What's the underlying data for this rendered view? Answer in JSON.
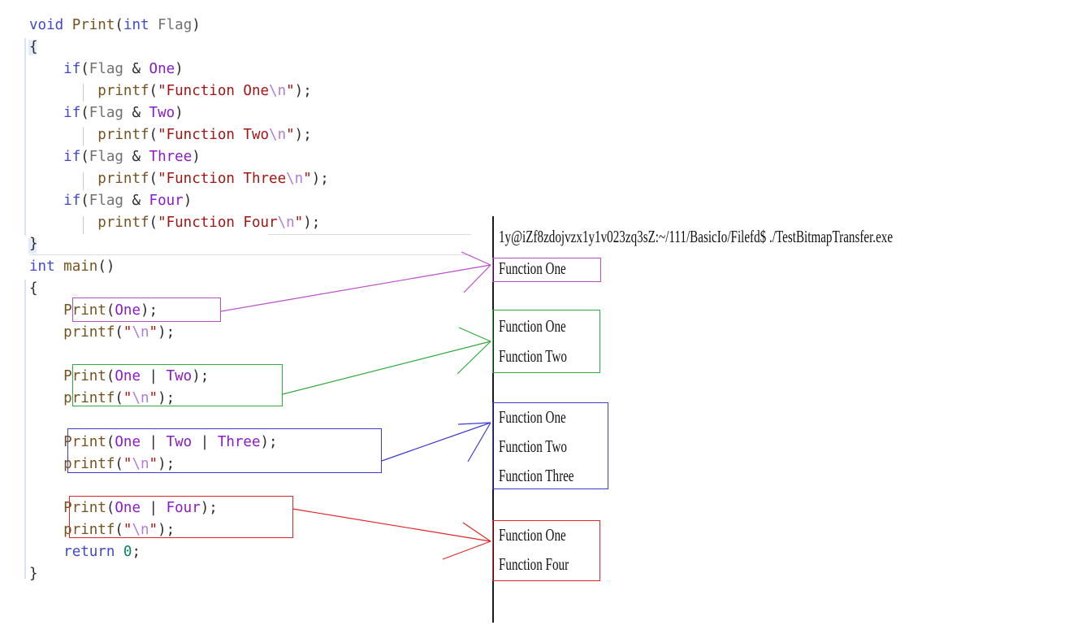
{
  "code": {
    "lines": [
      {
        "tokens": [
          {
            "t": "void",
            "c": "kw"
          },
          {
            "t": " ",
            "c": "punc"
          },
          {
            "t": "Print",
            "c": "fn"
          },
          {
            "t": "(",
            "c": "punc"
          },
          {
            "t": "int",
            "c": "kw"
          },
          {
            "t": " ",
            "c": "punc"
          },
          {
            "t": "Flag",
            "c": "var"
          },
          {
            "t": ")",
            "c": "punc"
          }
        ]
      },
      {
        "tokens": [
          {
            "t": "{",
            "c": "punc"
          }
        ]
      },
      {
        "tokens": [
          {
            "t": "    ",
            "c": "punc"
          },
          {
            "t": "if",
            "c": "kw"
          },
          {
            "t": "(",
            "c": "punc"
          },
          {
            "t": "Flag",
            "c": "var"
          },
          {
            "t": " & ",
            "c": "punc"
          },
          {
            "t": "One",
            "c": "macro"
          },
          {
            "t": ")",
            "c": "punc"
          }
        ]
      },
      {
        "tokens": [
          {
            "t": "        ",
            "c": "punc"
          },
          {
            "t": "printf",
            "c": "fn"
          },
          {
            "t": "(",
            "c": "punc"
          },
          {
            "t": "\"Function One",
            "c": "str"
          },
          {
            "t": "\\n",
            "c": "esc"
          },
          {
            "t": "\"",
            "c": "str"
          },
          {
            "t": ");",
            "c": "punc"
          }
        ]
      },
      {
        "tokens": [
          {
            "t": "    ",
            "c": "punc"
          },
          {
            "t": "if",
            "c": "kw"
          },
          {
            "t": "(",
            "c": "punc"
          },
          {
            "t": "Flag",
            "c": "var"
          },
          {
            "t": " & ",
            "c": "punc"
          },
          {
            "t": "Two",
            "c": "macro"
          },
          {
            "t": ")",
            "c": "punc"
          }
        ]
      },
      {
        "tokens": [
          {
            "t": "        ",
            "c": "punc"
          },
          {
            "t": "printf",
            "c": "fn"
          },
          {
            "t": "(",
            "c": "punc"
          },
          {
            "t": "\"Function Two",
            "c": "str"
          },
          {
            "t": "\\n",
            "c": "esc"
          },
          {
            "t": "\"",
            "c": "str"
          },
          {
            "t": ");",
            "c": "punc"
          }
        ]
      },
      {
        "tokens": [
          {
            "t": "    ",
            "c": "punc"
          },
          {
            "t": "if",
            "c": "kw"
          },
          {
            "t": "(",
            "c": "punc"
          },
          {
            "t": "Flag",
            "c": "var"
          },
          {
            "t": " & ",
            "c": "punc"
          },
          {
            "t": "Three",
            "c": "macro"
          },
          {
            "t": ")",
            "c": "punc"
          }
        ]
      },
      {
        "tokens": [
          {
            "t": "        ",
            "c": "punc"
          },
          {
            "t": "printf",
            "c": "fn"
          },
          {
            "t": "(",
            "c": "punc"
          },
          {
            "t": "\"Function Three",
            "c": "str"
          },
          {
            "t": "\\n",
            "c": "esc"
          },
          {
            "t": "\"",
            "c": "str"
          },
          {
            "t": ");",
            "c": "punc"
          }
        ]
      },
      {
        "tokens": [
          {
            "t": "    ",
            "c": "punc"
          },
          {
            "t": "if",
            "c": "kw"
          },
          {
            "t": "(",
            "c": "punc"
          },
          {
            "t": "Flag",
            "c": "var"
          },
          {
            "t": " & ",
            "c": "punc"
          },
          {
            "t": "Four",
            "c": "macro"
          },
          {
            "t": ")",
            "c": "punc"
          }
        ]
      },
      {
        "tokens": [
          {
            "t": "        ",
            "c": "punc"
          },
          {
            "t": "printf",
            "c": "fn"
          },
          {
            "t": "(",
            "c": "punc"
          },
          {
            "t": "\"Function Four",
            "c": "str"
          },
          {
            "t": "\\n",
            "c": "esc"
          },
          {
            "t": "\"",
            "c": "str"
          },
          {
            "t": ");",
            "c": "punc"
          }
        ]
      },
      {
        "tokens": [
          {
            "t": "}",
            "c": "punc"
          }
        ]
      },
      {
        "tokens": [
          {
            "t": "int",
            "c": "kw"
          },
          {
            "t": " ",
            "c": "punc"
          },
          {
            "t": "main",
            "c": "fn"
          },
          {
            "t": "()",
            "c": "punc"
          }
        ]
      },
      {
        "tokens": [
          {
            "t": "{",
            "c": "punc"
          }
        ]
      },
      {
        "tokens": [
          {
            "t": "    ",
            "c": "punc"
          },
          {
            "t": "Print",
            "c": "fn"
          },
          {
            "t": "(",
            "c": "punc"
          },
          {
            "t": "One",
            "c": "macro"
          },
          {
            "t": ");",
            "c": "punc"
          }
        ]
      },
      {
        "tokens": [
          {
            "t": "    ",
            "c": "punc"
          },
          {
            "t": "printf",
            "c": "fn"
          },
          {
            "t": "(",
            "c": "punc"
          },
          {
            "t": "\"",
            "c": "str"
          },
          {
            "t": "\\n",
            "c": "esc"
          },
          {
            "t": "\"",
            "c": "str"
          },
          {
            "t": ");",
            "c": "punc"
          }
        ]
      },
      {
        "tokens": []
      },
      {
        "tokens": [
          {
            "t": "    ",
            "c": "punc"
          },
          {
            "t": "Print",
            "c": "fn"
          },
          {
            "t": "(",
            "c": "punc"
          },
          {
            "t": "One",
            "c": "macro"
          },
          {
            "t": " | ",
            "c": "punc"
          },
          {
            "t": "Two",
            "c": "macro"
          },
          {
            "t": ");",
            "c": "punc"
          }
        ]
      },
      {
        "tokens": [
          {
            "t": "    ",
            "c": "punc"
          },
          {
            "t": "printf",
            "c": "fn"
          },
          {
            "t": "(",
            "c": "punc"
          },
          {
            "t": "\"",
            "c": "str"
          },
          {
            "t": "\\n",
            "c": "esc"
          },
          {
            "t": "\"",
            "c": "str"
          },
          {
            "t": ");",
            "c": "punc"
          }
        ]
      },
      {
        "tokens": []
      },
      {
        "tokens": [
          {
            "t": "    ",
            "c": "punc"
          },
          {
            "t": "Print",
            "c": "fn"
          },
          {
            "t": "(",
            "c": "punc"
          },
          {
            "t": "One",
            "c": "macro"
          },
          {
            "t": " | ",
            "c": "punc"
          },
          {
            "t": "Two",
            "c": "macro"
          },
          {
            "t": " | ",
            "c": "punc"
          },
          {
            "t": "Three",
            "c": "macro"
          },
          {
            "t": ");",
            "c": "punc"
          }
        ]
      },
      {
        "tokens": [
          {
            "t": "    ",
            "c": "punc"
          },
          {
            "t": "printf",
            "c": "fn"
          },
          {
            "t": "(",
            "c": "punc"
          },
          {
            "t": "\"",
            "c": "str"
          },
          {
            "t": "\\n",
            "c": "esc"
          },
          {
            "t": "\"",
            "c": "str"
          },
          {
            "t": ");",
            "c": "punc"
          }
        ]
      },
      {
        "tokens": []
      },
      {
        "tokens": [
          {
            "t": "    ",
            "c": "punc"
          },
          {
            "t": "Print",
            "c": "fn"
          },
          {
            "t": "(",
            "c": "punc"
          },
          {
            "t": "One",
            "c": "macro"
          },
          {
            "t": " | ",
            "c": "punc"
          },
          {
            "t": "Four",
            "c": "macro"
          },
          {
            "t": ");",
            "c": "punc"
          }
        ]
      },
      {
        "tokens": [
          {
            "t": "    ",
            "c": "punc"
          },
          {
            "t": "printf",
            "c": "fn"
          },
          {
            "t": "(",
            "c": "punc"
          },
          {
            "t": "\"",
            "c": "str"
          },
          {
            "t": "\\n",
            "c": "esc"
          },
          {
            "t": "\"",
            "c": "str"
          },
          {
            "t": ");",
            "c": "punc"
          }
        ]
      },
      {
        "tokens": [
          {
            "t": "    ",
            "c": "punc"
          },
          {
            "t": "return",
            "c": "kw"
          },
          {
            "t": " ",
            "c": "punc"
          },
          {
            "t": "0",
            "c": "num"
          },
          {
            "t": ";",
            "c": "punc"
          }
        ]
      },
      {
        "tokens": [
          {
            "t": "}",
            "c": "punc"
          }
        ]
      }
    ]
  },
  "terminal": {
    "command": "1y@iZf8zdojvzx1y1v023zq3sZ:~/111/BasicIo/Filefd$ ./TestBitmapTransfer.exe",
    "groups": [
      {
        "lines": [
          "Function One"
        ]
      },
      {
        "lines": [
          "Function One",
          "Function Two"
        ]
      },
      {
        "lines": [
          "Function One",
          "Function Two",
          "Function Three"
        ]
      },
      {
        "lines": [
          "Function One",
          "Function Four"
        ]
      }
    ]
  },
  "colors": {
    "group1": "#b84fc6",
    "group2": "#2eaa3e",
    "group3": "#3b3bd0",
    "group4": "#e02626"
  }
}
